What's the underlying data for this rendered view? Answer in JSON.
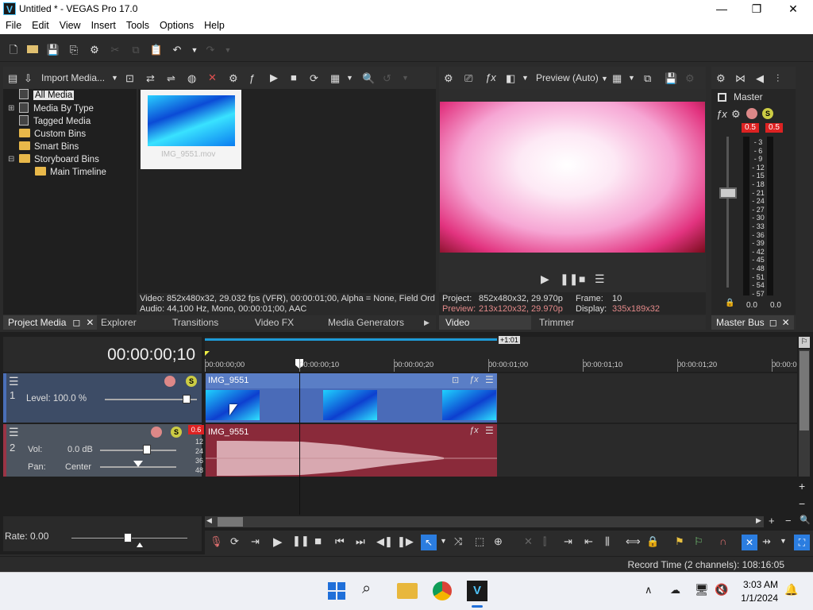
{
  "window": {
    "title": "Untitled * - VEGAS Pro 17.0",
    "app_icon": "V",
    "minimize": "—",
    "maximize": "❐",
    "close": "✕"
  },
  "menu": [
    "File",
    "Edit",
    "View",
    "Insert",
    "Tools",
    "Options",
    "Help"
  ],
  "project_media": {
    "import_label": "Import Media...",
    "tree": [
      "All Media",
      "Media By Type",
      "Tagged Media",
      "Custom Bins",
      "Smart Bins",
      "Storyboard Bins",
      "Main Timeline"
    ],
    "thumb_name": "IMG_9551.mov",
    "info_video": "Video: 852x480x32, 29.032 fps (VFR), 00:00:01;00, Alpha = None, Field Ord",
    "info_audio": "Audio: 44,100 Hz, Mono, 00:00:01;00, AAC",
    "tabs": [
      "Project Media",
      "Explorer",
      "Transitions",
      "Video FX",
      "Media Generators"
    ]
  },
  "preview": {
    "mode": "Preview (Auto)",
    "project_label": "Project:",
    "project_value": "852x480x32, 29.970p",
    "preview_label": "Preview:",
    "preview_value": "213x120x32, 29.970p",
    "frame_label": "Frame:",
    "frame_value": "10",
    "display_label": "Display:",
    "display_value": "335x189x32",
    "tabs": [
      "Video Preview",
      "Trimmer"
    ]
  },
  "master": {
    "label": "Master",
    "peak_l": "0.5",
    "peak_r": "0.5",
    "scale": [
      "3",
      "6",
      "9",
      "12",
      "15",
      "18",
      "21",
      "24",
      "27",
      "30",
      "33",
      "36",
      "39",
      "42",
      "45",
      "48",
      "51",
      "54",
      "57"
    ],
    "val_l": "0.0",
    "val_r": "0.0",
    "tab": "Master Bus"
  },
  "timeline": {
    "timecode": "00:00:00;10",
    "loop_end": "+1:01",
    "ruler": [
      "00:00:00;00",
      "00:00:00;10",
      "00:00:00;20",
      "00:00:01;00",
      "00:00:01;10",
      "00:00:01;20",
      "00:00:0"
    ],
    "track1": {
      "num": "1",
      "level_label": "Level: 100.0 %",
      "clip": "IMG_9551",
      "level": 1.0
    },
    "track2": {
      "num": "2",
      "peak": "0.6",
      "vol_label": "Vol:",
      "vol_value": "0.0 dB",
      "pan_label": "Pan:",
      "pan_value": "Center",
      "clip": "IMG_9551",
      "db": [
        "12",
        "24",
        "36",
        "48"
      ]
    },
    "rate": "Rate: 0.00",
    "record_time": "Record Time (2 channels): 108:16:05"
  },
  "taskbar": {
    "time": "3:03 AM",
    "date": "1/1/2024"
  },
  "colors": {
    "video_track": "#3d5a9a",
    "audio_track": "#8a2a3a",
    "accent": "#4fc3f7"
  }
}
